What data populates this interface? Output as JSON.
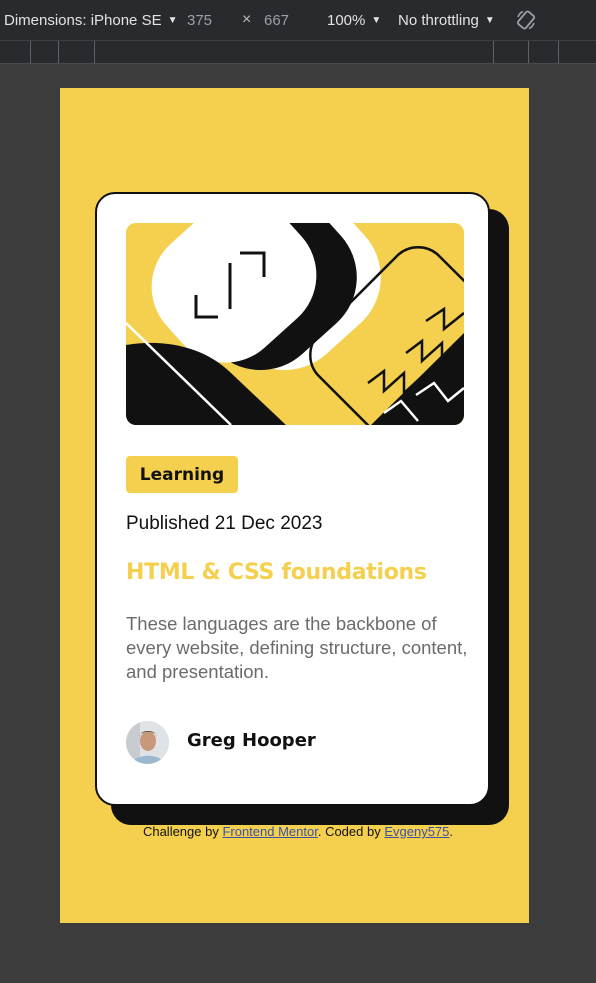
{
  "devtools": {
    "dimensions_label": "Dimensions: iPhone SE",
    "width": "375",
    "times": "×",
    "height": "667",
    "zoom": "100%",
    "throttling": "No throttling",
    "rotate_icon": "rotate-icon"
  },
  "card": {
    "tag": "Learning",
    "published": "Published 21 Dec 2023",
    "title": "HTML & CSS foundations",
    "description": "These languages are the backbone of every website, defining structure, content, and presentation.",
    "author": "Greg Hooper"
  },
  "attribution": {
    "prefix": "Challenge by ",
    "link1": "Frontend Mentor",
    "middle": ". Coded by ",
    "link2": "Evgeny575",
    "suffix": "."
  },
  "colors": {
    "accent": "#f4d04e",
    "dark": "#111111",
    "muted": "#6b6b6b",
    "page_bg": "#3c3c3c"
  }
}
